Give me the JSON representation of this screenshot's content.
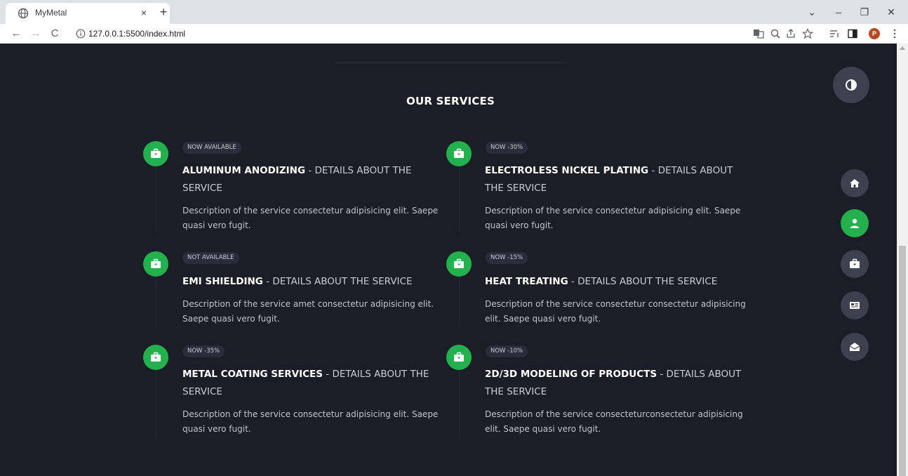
{
  "browser": {
    "tab_title": "MyMetal",
    "tab_close": "×",
    "new_tab": "+",
    "url": "127.0.0.1:5500/index.html",
    "window_controls": {
      "minimize": "–",
      "restore": "❐",
      "close": "✕",
      "tab_search": "⌄"
    },
    "nav": {
      "back": "←",
      "forward": "→",
      "reload": "C"
    },
    "profile_initial": "P",
    "toolbar_icons": [
      "translate-icon",
      "zoom-icon",
      "share-icon",
      "star-icon",
      "reading-list-icon",
      "side-panel-icon",
      "menu-icon"
    ]
  },
  "page": {
    "section_title": "OUR SERVICES",
    "accent_color": "#22b14c",
    "services": [
      {
        "badge": "NOW AVAILABLE",
        "name": "ALUMINUM ANODIZING",
        "sep": " - ",
        "details": "DETAILS ABOUT THE SERVICE",
        "description": "Description of the service consectetur adipisicing elit. Saepe quasi vero fugit."
      },
      {
        "badge": "NOW -30%",
        "name": "ELECTROLESS NICKEL PLATING",
        "sep": " - ",
        "details": "DETAILS ABOUT THE SERVICE",
        "description": "Description of the service consectetur adipisicing elit. Saepe quasi vero fugit."
      },
      {
        "badge": "NOT AVAILABLE",
        "name": "EMI SHIELDING",
        "sep": " - ",
        "details": "DETAILS ABOUT THE SERVICE",
        "description": "Description of the service amet consectetur adipisicing elit. Saepe quasi vero fugit."
      },
      {
        "badge": "NOW -15%",
        "name": "HEAT TREATING",
        "sep": " - ",
        "details": "DETAILS ABOUT THE SERVICE",
        "description": "Description of the service consectetur consectetur adipisicing elit. Saepe quasi vero fugit."
      },
      {
        "badge": "NOW -35%",
        "name": "METAL COATING SERVICES",
        "sep": " - ",
        "details": "DETAILS ABOUT THE SERVICE",
        "description": "Description of the service consectetur adipisicing elit. Saepe quasi vero fugit."
      },
      {
        "badge": "NOW -10%",
        "name": "2D/3D MODELING OF PRODUCTS",
        "sep": " - ",
        "details": "DETAILS ABOUT THE SERVICE",
        "description": "Description of the service consecteturconsectetur adipisicing elit. Saepe quasi vero fugit."
      }
    ],
    "side_nav": [
      {
        "icon": "home-icon",
        "active": false
      },
      {
        "icon": "user-icon",
        "active": true
      },
      {
        "icon": "briefcase-icon",
        "active": false
      },
      {
        "icon": "newspaper-icon",
        "active": false
      },
      {
        "icon": "envelope-open-icon",
        "active": false
      }
    ],
    "theme_toggle_icon": "half-circle-icon"
  }
}
